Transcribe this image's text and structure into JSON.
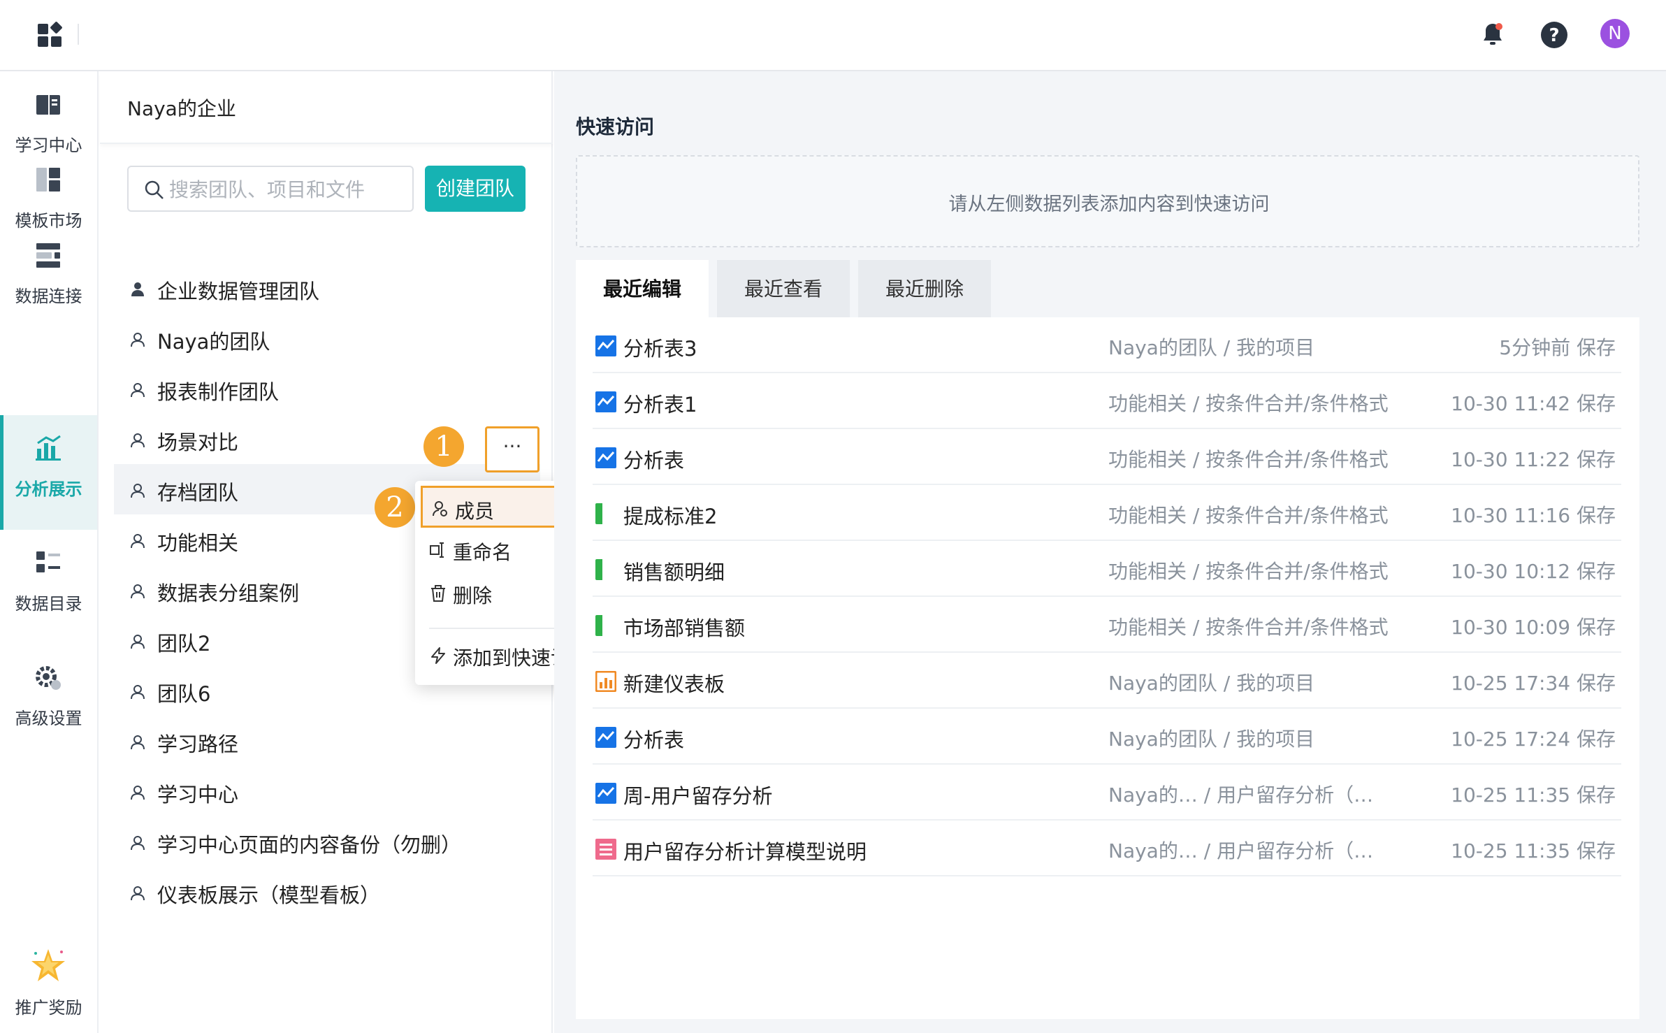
{
  "colors": {
    "accent": "#16b3b3",
    "highlight": "#f0a02a",
    "avatar": "#9b51e0"
  },
  "topbar": {
    "avatar_letter": "N"
  },
  "nav": {
    "items": [
      {
        "label": "学习中心",
        "icon": "book-icon"
      },
      {
        "label": "模板市场",
        "icon": "template-icon"
      },
      {
        "label": "数据连接",
        "icon": "data-connect-icon"
      },
      {
        "label": "分析展示",
        "icon": "analysis-icon",
        "active": true
      },
      {
        "label": "数据目录",
        "icon": "catalog-icon"
      },
      {
        "label": "高级设置",
        "icon": "settings-icon"
      },
      {
        "label": "推广奖励",
        "icon": "star-icon"
      }
    ]
  },
  "teampanel": {
    "org_name": "Naya的企业",
    "search_placeholder": "搜索团队、项目和文件",
    "create_label": "创建团队",
    "teams": [
      "企业数据管理团队",
      "Naya的团队",
      "报表制作团队",
      "场景对比",
      "存档团队",
      "功能相关",
      "数据表分组案例",
      "团队2",
      "团队6",
      "学习路径",
      "学习中心",
      "学习中心页面的内容备份（勿删）",
      "仪表板展示（模型看板）"
    ],
    "more_label": "···",
    "badge1": "1",
    "badge2": "2"
  },
  "context_menu": {
    "items": [
      "成员",
      "重命名",
      "删除",
      "添加到快速访问"
    ]
  },
  "main": {
    "quick_access_title": "快速访问",
    "quick_access_empty": "请从左侧数据列表添加内容到快速访问",
    "tabs": [
      "最近编辑",
      "最近查看",
      "最近删除"
    ],
    "files": [
      {
        "name": "分析表3",
        "path": "Naya的团队 / 我的项目",
        "time": "5分钟前 保存",
        "type": "analysis"
      },
      {
        "name": "分析表1",
        "path": "功能相关 / 按条件合并/条件格式",
        "time": "10-30 11:42 保存",
        "type": "analysis"
      },
      {
        "name": "分析表",
        "path": "功能相关 / 按条件合并/条件格式",
        "time": "10-30 11:22 保存",
        "type": "analysis"
      },
      {
        "name": "提成标准2",
        "path": "功能相关 / 按条件合并/条件格式",
        "time": "10-30 11:16 保存",
        "type": "sheet"
      },
      {
        "name": "销售额明细",
        "path": "功能相关 / 按条件合并/条件格式",
        "time": "10-30 10:12 保存",
        "type": "sheet"
      },
      {
        "name": "市场部销售额",
        "path": "功能相关 / 按条件合并/条件格式",
        "time": "10-30 10:09 保存",
        "type": "sheet"
      },
      {
        "name": "新建仪表板",
        "path": "Naya的团队 / 我的项目",
        "time": "10-25 17:34 保存",
        "type": "dashboard"
      },
      {
        "name": "分析表",
        "path": "Naya的团队 / 我的项目",
        "time": "10-25 17:24 保存",
        "type": "analysis"
      },
      {
        "name": "周-用户留存分析",
        "path": "Naya的…  / 用户留存分析（…",
        "time": "10-25 11:35 保存",
        "type": "analysis"
      },
      {
        "name": "用户留存分析计算模型说明",
        "path": "Naya的…  / 用户留存分析（…",
        "time": "10-25 11:35 保存",
        "type": "doc"
      }
    ]
  }
}
